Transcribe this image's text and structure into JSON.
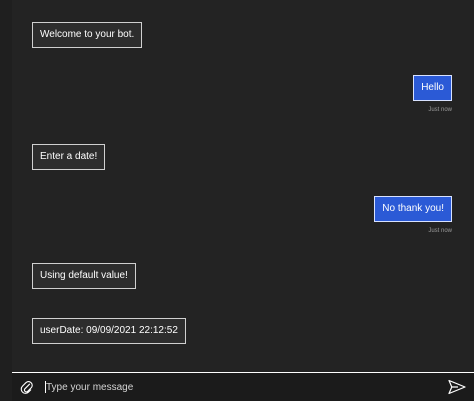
{
  "messages": [
    {
      "role": "bot",
      "text": "Welcome to your bot."
    },
    {
      "role": "user",
      "text": "Hello",
      "timestamp": "Just now"
    },
    {
      "role": "bot",
      "text": "Enter a date!"
    },
    {
      "role": "user",
      "text": "No thank you!",
      "timestamp": "Just now"
    },
    {
      "role": "bot",
      "text": "Using default value!"
    },
    {
      "role": "bot",
      "text": "userDate: 09/09/2021 22:12:52"
    }
  ],
  "composer": {
    "placeholder": "Type your message",
    "value": ""
  },
  "icons": {
    "attach": "paperclip-icon",
    "send": "send-icon"
  },
  "colors": {
    "background": "#232323",
    "user_bubble": "#2b5ad6",
    "bot_border": "#d0d0d0",
    "text": "#ffffff",
    "timestamp": "#9a9a9a"
  }
}
